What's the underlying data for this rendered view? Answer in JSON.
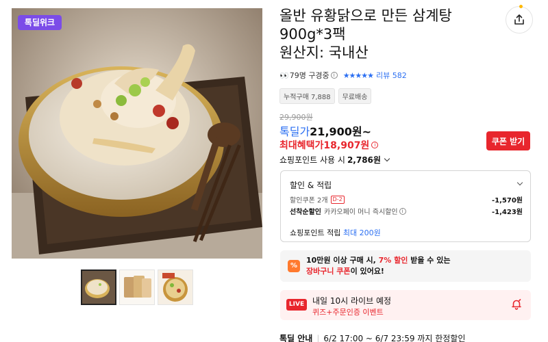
{
  "product": {
    "badge": "톡딜위크",
    "title_lines": [
      "올반 유황닭으로 만든 삼계탕",
      "900g*3팩",
      "원산지: 국내산"
    ]
  },
  "meta": {
    "eyes_icon": "👀",
    "viewers": "79명 구경중",
    "info_icon": "i",
    "stars": "★★★★★",
    "review": "리뷰 582"
  },
  "chips": [
    "누적구매 7,888",
    "무료배송"
  ],
  "price": {
    "original": "29,900원",
    "deal_label": "톡딜가",
    "deal_price": "21,900원~",
    "max_label": "최대혜택가",
    "max_price": "18,907원",
    "coupon_button": "쿠폰 받기",
    "points_label": "쇼핑포인트 사용 시",
    "points_amount": "2,786원"
  },
  "discount": {
    "header": "할인 & 적립",
    "coupon_label": "할인쿠폰 2개",
    "coupon_dday": "D-2",
    "coupon_value": "-1,570원",
    "first_label": "선착순할인",
    "first_desc": "카카오페이 머니 즉시할인",
    "first_value": "-1,423원",
    "points_label": "쇼핑포인트 적립",
    "points_highlight": "최대 200원"
  },
  "promo": {
    "icon": "%",
    "line1_a": "10만원 이상 구매 시, ",
    "line1_hl": "7% 할인",
    "line1_b": " 받을 수 있는",
    "line2_hl": "장바구니 쿠폰",
    "line2_b": "이 있어요!"
  },
  "live": {
    "badge": "LIVE",
    "title": "내일 10시 라이브 예정",
    "subtitle": "퀴즈+주문인증 이벤트"
  },
  "deal": {
    "label": "톡딜 안내",
    "sep": "|",
    "text": "6/2 17:00 ~ 6/7 23:59 까지 한정할인"
  },
  "colors": {
    "brand_blue": "#2b6ff2",
    "sale_red": "#e8262d",
    "badge_purple": "#7b4ce8"
  }
}
